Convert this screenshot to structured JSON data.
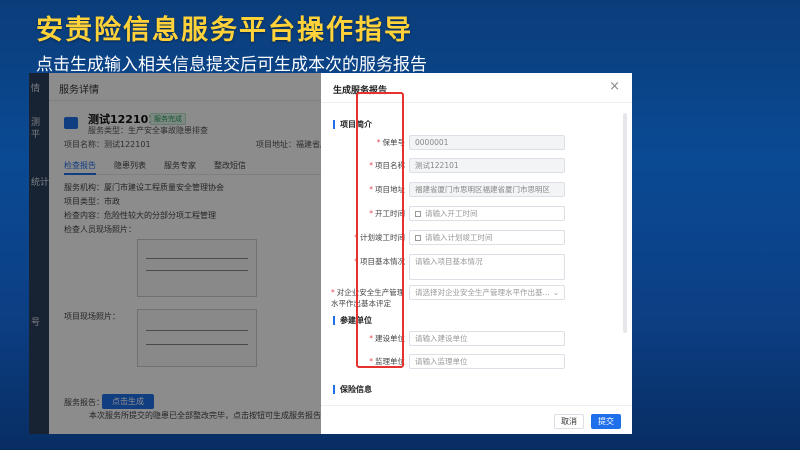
{
  "slide": {
    "title": "安责险信息服务平台操作指导",
    "subtitle": "点击生成输入相关信息提交后可生成本次的服务报告"
  },
  "background_app": {
    "nav_items": [
      "情",
      "测",
      "平",
      "统计",
      "号"
    ],
    "header_title": "服务详情",
    "project": {
      "name": "测试122101",
      "badge": "服务完成",
      "service_type": "服务类型：生产安全事故隐患排查",
      "project_name": "项目名称：测试122101",
      "address": "项目地址：福建省厦门"
    },
    "tabs": [
      "检查报告",
      "隐患列表",
      "服务专家",
      "整改短信"
    ],
    "info": {
      "agency": "服务机构：厦门市建设工程质量安全管理协会",
      "project_type": "项目类型：市政",
      "content": "检查内容：危险性较大的分部分项工程管理",
      "site_photo": "检查人员现场照片：",
      "project_photo": "项目现场照片：",
      "report_label": "服务报告：",
      "generate_button": "点击生成",
      "note": "本次服务所提交的隐患已全部整改完毕，点击按钮可生成服务报告"
    }
  },
  "modal": {
    "title": "生成服务报告",
    "close": "×",
    "sections": {
      "project_intro": "项目简介",
      "participants": "参建单位",
      "insurance": "保险信息"
    },
    "fields": {
      "policy_no": {
        "label": "保单号",
        "value": "0000001"
      },
      "project_name": {
        "label": "项目名称",
        "value": "测试122101"
      },
      "project_address": {
        "label": "项目地址",
        "value": "福建省厦门市思明区福建省厦门市思明区"
      },
      "start_date": {
        "label": "开工时间",
        "placeholder": "请输入开工时间"
      },
      "planned_completion": {
        "label": "计划竣工时间",
        "placeholder": "请输入计划竣工时间"
      },
      "project_basic": {
        "label": "项目基本情况",
        "placeholder": "请输入项目基本情况"
      },
      "safety_level": {
        "label": "对企业安全生产管理水平作出基本评定",
        "placeholder": "请选择对企业安全生产管理水平作出基..."
      },
      "construction_unit": {
        "label": "建设单位",
        "placeholder": "请输入建设单位"
      },
      "supervision_unit": {
        "label": "监理单位",
        "placeholder": "请输入监理单位"
      }
    },
    "cancel_button": "取消",
    "submit_button": "提交"
  },
  "colors": {
    "title_yellow": "#ffd23a",
    "primary_blue": "#1f6feb",
    "highlight_red": "#e5322d"
  }
}
